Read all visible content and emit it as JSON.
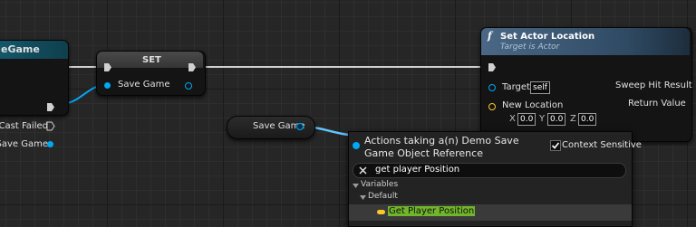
{
  "nodes": {
    "cast": {
      "title_fragment": "eGame",
      "cast_failed": "Cast Failed",
      "as_save_game": "mo Save Game"
    },
    "set": {
      "title": "SET",
      "pin_label": "Save Game"
    },
    "get_var": {
      "label": "Save Game"
    },
    "set_actor_location": {
      "title": "Set Actor Location",
      "subtitle": "Target is Actor",
      "function_icon": "f",
      "target_label": "Target",
      "target_value": "self",
      "new_location_label": "New Location",
      "x_label": "X",
      "x_value": "0.0",
      "y_label": "Y",
      "y_value": "0.0",
      "z_label": "Z",
      "z_value": "0.0",
      "sweep_hit_result": "Sweep Hit Result",
      "return_value": "Return Value"
    }
  },
  "context_menu": {
    "title": "Actions taking a(n) Demo Save Game Object Reference",
    "context_sensitive_label": "Context Sensitive",
    "context_sensitive_checked": true,
    "search_value": "get player Position",
    "category": "Variables",
    "subcategory": "Default",
    "item": "Get Player Position",
    "highlight_text": "Get Player Position"
  },
  "colors": {
    "object_pin": "#00a8f4",
    "vector_pin": "#fdc827",
    "function_header": "#3e5872",
    "set_header": "#3b3b3b",
    "search_highlight": "#71b52a"
  }
}
